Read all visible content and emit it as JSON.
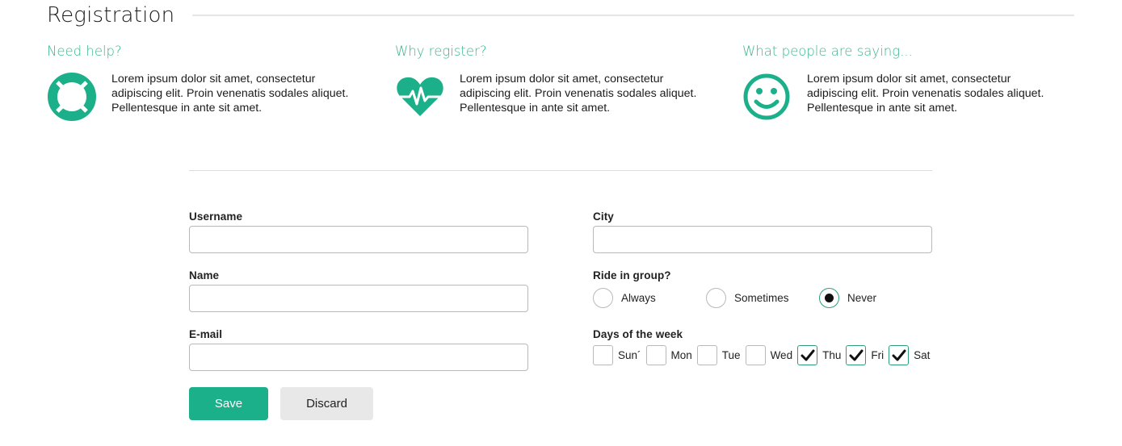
{
  "page": {
    "title": "Registration"
  },
  "info": [
    {
      "heading": "Need help?",
      "icon": "lifebuoy-icon",
      "text": "Lorem ipsum dolor sit amet, consectetur adipiscing elit. Proin venenatis sodales aliquet. Pellentesque in ante sit amet."
    },
    {
      "heading": "Why register?",
      "icon": "heartbeat-icon",
      "text": "Lorem ipsum dolor sit amet, consectetur adipiscing elit. Proin venenatis sodales aliquet. Pellentesque in ante sit amet."
    },
    {
      "heading": "What people are saying...",
      "icon": "smiley-icon",
      "text": "Lorem ipsum dolor sit amet, consectetur adipiscing elit. Proin venenatis sodales aliquet. Pellentesque in ante sit amet."
    }
  ],
  "form": {
    "username": {
      "label": "Username",
      "value": ""
    },
    "name": {
      "label": "Name",
      "value": ""
    },
    "email": {
      "label": "E-mail",
      "value": ""
    },
    "city": {
      "label": "City",
      "value": ""
    },
    "ride": {
      "label": "Ride in group?",
      "options": [
        "Always",
        "Sometimes",
        "Never"
      ],
      "selected": "Never"
    },
    "days": {
      "label": "Days of the week",
      "options": [
        {
          "label": "Sun´",
          "checked": false
        },
        {
          "label": "Mon",
          "checked": false
        },
        {
          "label": "Tue",
          "checked": false
        },
        {
          "label": "Wed",
          "checked": false
        },
        {
          "label": "Thu",
          "checked": true
        },
        {
          "label": "Fri",
          "checked": true
        },
        {
          "label": "Sat",
          "checked": true
        }
      ]
    },
    "save_label": "Save",
    "discard_label": "Discard"
  },
  "colors": {
    "accent": "#1bb08a",
    "heading": "#3bb58c"
  }
}
